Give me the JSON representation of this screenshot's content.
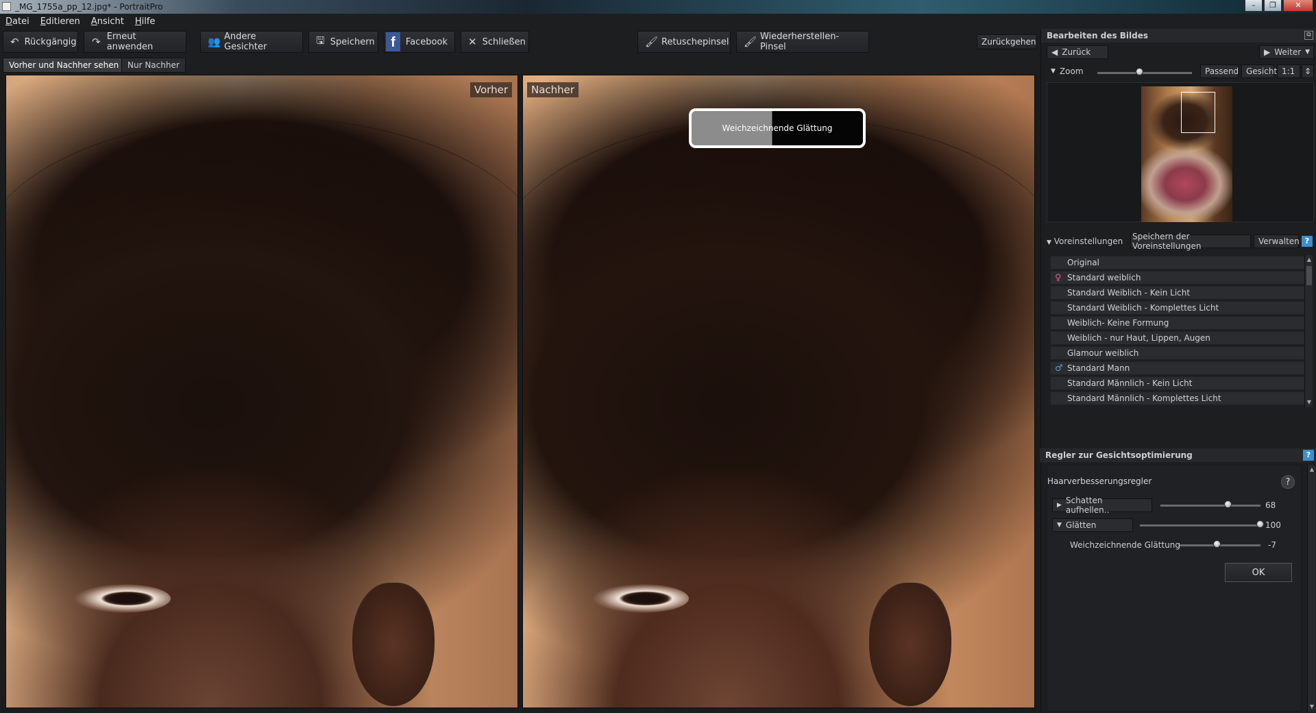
{
  "window": {
    "title": "_MG_1755a_pp_12.jpg* - PortraitPro"
  },
  "menu": [
    "Datei",
    "Editieren",
    "Ansicht",
    "Hilfe"
  ],
  "toolbar": {
    "undo": "Rückgängig",
    "redo": "Erneut anwenden",
    "other_faces": "Andere Gesichter",
    "save": "Speichern",
    "facebook": "Facebook",
    "close": "Schließen",
    "retouch_brush": "Retuschepinsel",
    "restore_brush": "Wiederherstellen-Pinsel",
    "back": "Zurückgehen"
  },
  "view_tabs": [
    {
      "label": "Vorher und Nachher sehen",
      "active": true
    },
    {
      "label": "Nur Nachher",
      "active": false
    }
  ],
  "photos": {
    "before_label": "Vorher",
    "after_label": "Nachher"
  },
  "tooltip": {
    "text": "Weichzeichnende Glättung"
  },
  "edit_panel": {
    "header": "Bearbeiten des Bildes",
    "back": "Zurück",
    "next": "Weiter",
    "zoom": "Zoom",
    "zoom_level": 0.45,
    "fit": "Passend",
    "face": "Gesicht",
    "one_to_one": "1:1"
  },
  "presets": {
    "header": "Voreinstellungen",
    "save": "Speichern der Voreinstellungen",
    "manage": "Verwalten",
    "items": [
      {
        "label": "Original",
        "icon": ""
      },
      {
        "label": "Standard weiblich",
        "icon": "female-icon"
      },
      {
        "label": "Standard Weiblich - Kein Licht",
        "icon": ""
      },
      {
        "label": "Standard Weiblich - Komplettes Licht",
        "icon": ""
      },
      {
        "label": "Weiblich- Keine Formung",
        "icon": ""
      },
      {
        "label": "Weiblich - nur Haut, Lippen, Augen",
        "icon": ""
      },
      {
        "label": "Glamour weiblich",
        "icon": ""
      },
      {
        "label": "Standard Mann",
        "icon": "male-icon"
      },
      {
        "label": "Standard Männlich - Kein Licht",
        "icon": ""
      },
      {
        "label": "Standard Männlich - Komplettes Licht",
        "icon": ""
      }
    ]
  },
  "sliders": {
    "header": "Regler zur Gesichtsoptimierung",
    "group": "Haarverbesserungsregler",
    "items": [
      {
        "label": "Schatten aufhellen..",
        "value": "68",
        "level": 0.68
      },
      {
        "label": "Glätten",
        "value": "100",
        "level": 1.0
      },
      {
        "label": "Weichzeichnende Glättung",
        "value": "-7",
        "level": 0.465
      }
    ],
    "ok": "OK"
  }
}
